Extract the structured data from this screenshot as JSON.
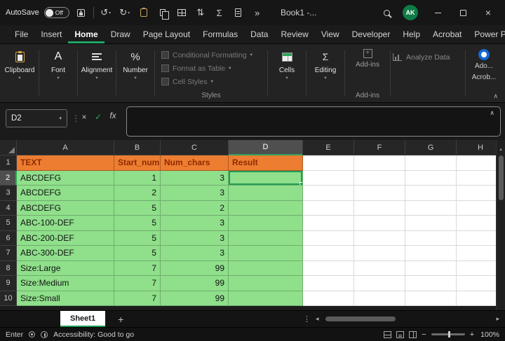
{
  "titlebar": {
    "autosave_label": "AutoSave",
    "autosave_state": "Off",
    "title": "Book1  -...",
    "avatar_initials": "AK"
  },
  "menubar": {
    "items": [
      "File",
      "Insert",
      "Home",
      "Draw",
      "Page Layout",
      "Formulas",
      "Data",
      "Review",
      "View",
      "Developer",
      "Help",
      "Acrobat",
      "Power Pivot"
    ],
    "active": "Home"
  },
  "ribbon": {
    "clipboard": "Clipboard",
    "font": "Font",
    "alignment": "Alignment",
    "number": "Number",
    "conditional_formatting": "Conditional Formatting",
    "format_as_table": "Format as Table",
    "cell_styles": "Cell Styles",
    "styles_group": "Styles",
    "cells": "Cells",
    "editing": "Editing",
    "addins_button": "Add-ins",
    "addins_group": "Add-ins",
    "analyze_data": "Analyze Data",
    "acrobat_line1": "Ado...",
    "acrobat_line2": "Acrob..."
  },
  "formula_bar": {
    "name_box": "D2",
    "cancel": "×",
    "enter": "✓",
    "fx": "fx",
    "formula": ""
  },
  "grid": {
    "columns": [
      "A",
      "B",
      "C",
      "D",
      "E",
      "F",
      "G",
      "H"
    ],
    "active_cell": "D2",
    "rows": [
      {
        "n": "1",
        "cells": [
          "TEXT",
          "Start_num",
          "Num_chars",
          "Result"
        ]
      },
      {
        "n": "2",
        "cells": [
          "ABCDEFG",
          "1",
          "3",
          ""
        ]
      },
      {
        "n": "3",
        "cells": [
          "ABCDEFG",
          "2",
          "3",
          ""
        ]
      },
      {
        "n": "4",
        "cells": [
          "ABCDEFG",
          "5",
          "2",
          ""
        ]
      },
      {
        "n": "5",
        "cells": [
          "ABC-100-DEF",
          "5",
          "3",
          ""
        ]
      },
      {
        "n": "6",
        "cells": [
          "ABC-200-DEF",
          "5",
          "3",
          ""
        ]
      },
      {
        "n": "7",
        "cells": [
          "ABC-300-DEF",
          "5",
          "3",
          ""
        ]
      },
      {
        "n": "8",
        "cells": [
          "Size:Large",
          "7",
          "99",
          ""
        ]
      },
      {
        "n": "9",
        "cells": [
          "Size:Medium",
          "7",
          "99",
          ""
        ]
      },
      {
        "n": "10",
        "cells": [
          "Size:Small",
          "7",
          "99",
          ""
        ]
      }
    ]
  },
  "sheet_tabs": {
    "active": "Sheet1"
  },
  "status_bar": {
    "mode": "Enter",
    "accessibility": "Accessibility: Good to go",
    "zoom": "100%"
  },
  "colors": {
    "header_fill": "#ED7D31",
    "header_text": "#8F2B00",
    "data_fill": "#8FDF8B",
    "selection_green": "#1F9D54",
    "accent_green": "#21A366",
    "acrobat_blue": "#1268D3"
  }
}
